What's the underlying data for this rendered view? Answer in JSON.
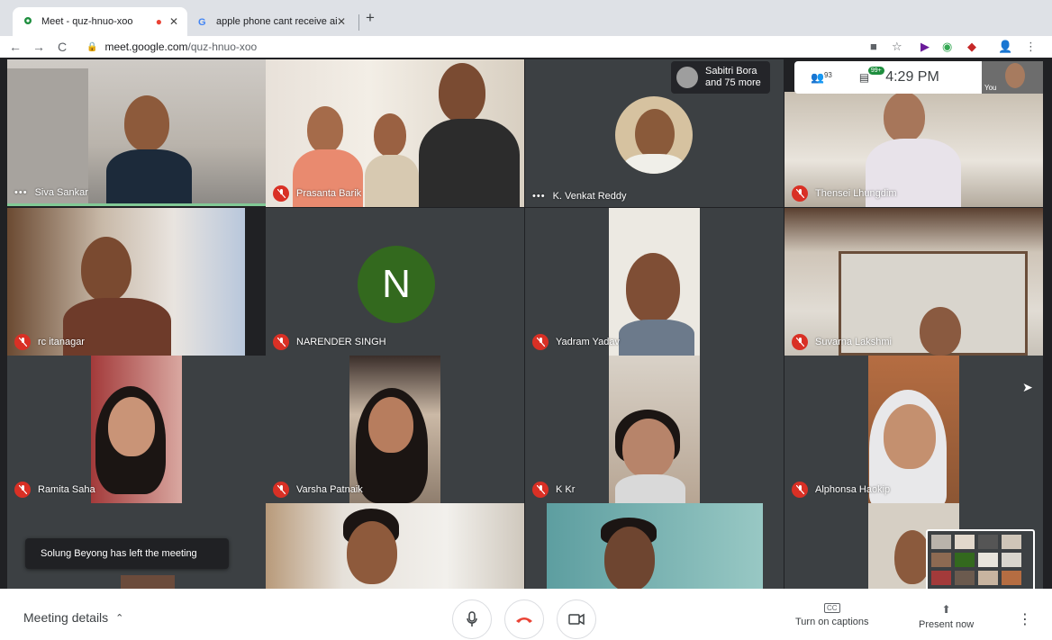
{
  "browser": {
    "tabs": [
      {
        "title": "Meet - quz-hnuo-xoo",
        "active": true,
        "recording_indicator": true
      },
      {
        "title": "apple phone cant receive aird",
        "active": false
      }
    ],
    "url_host": "meet.google.com",
    "url_path": "/quz-hnuo-xoo"
  },
  "meeting": {
    "participants_count": "93",
    "chat_badge": "99+",
    "time": "4:29 PM",
    "self_label": "You",
    "overflow": {
      "line1": "Sabitri Bora",
      "line2": "and 75 more"
    },
    "toast": "Solung Beyong has left the meeting",
    "tiles": [
      {
        "name": "Siva Sankar",
        "muted": false
      },
      {
        "name": "Prasanta Barik",
        "muted": true
      },
      {
        "name": "K. Venkat Reddy",
        "muted": false
      },
      {
        "name": "Thensei Lhungdim",
        "muted": true
      },
      {
        "name": "rc itanagar",
        "muted": true
      },
      {
        "name": "NARENDER SINGH",
        "muted": true,
        "initial": "N"
      },
      {
        "name": "Yadram Yadav",
        "muted": true
      },
      {
        "name": "Suvarna Lakshmi",
        "muted": true
      },
      {
        "name": "Ramita Saha",
        "muted": true
      },
      {
        "name": "Varsha Patnaik",
        "muted": true
      },
      {
        "name": "K Kr",
        "muted": true
      },
      {
        "name": "Alphonsa Haokip",
        "muted": true
      }
    ]
  },
  "controls": {
    "meeting_details": "Meeting details",
    "captions_label": "Turn on captions",
    "captions_icon": "CC",
    "present_label": "Present now"
  },
  "colors": {
    "mute_red": "#d93025",
    "speaking_green": "#81c995",
    "avatar_green": "#33691e",
    "hangup_red": "#ea4335"
  }
}
